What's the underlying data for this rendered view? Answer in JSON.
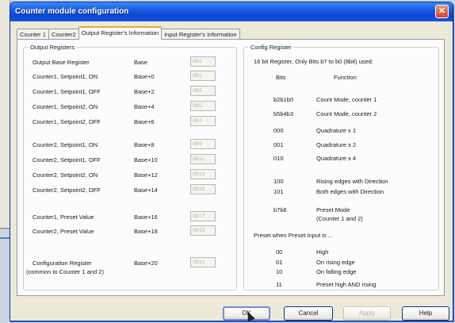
{
  "dialog": {
    "title": "Counter module configuration",
    "close_glyph": "✕"
  },
  "tabs": [
    {
      "label": "Counter 1"
    },
    {
      "label": "Counter2"
    },
    {
      "label": "Output Register's Information"
    },
    {
      "label": "Input Register's Information"
    }
  ],
  "output_registers": {
    "title": "Output Registers",
    "rows": [
      {
        "label": "Output Base Register",
        "base": "Base",
        "value": "0B1"
      },
      {
        "label": "Counter1, Setpoint1, ON",
        "base": "Base+0",
        "value": "0B1"
      },
      {
        "label": "Counter1, Setpoint1, OFF",
        "base": "Base+2",
        "value": "0B3"
      },
      {
        "label": "Counter1, Setpoint2, ON",
        "base": "Base+4",
        "value": "0B5"
      },
      {
        "label": "Counter1, Setpoint2, OFF",
        "base": "Base+6",
        "value": "0B7"
      },
      {
        "label": "Counter2, Setpoint1, ON",
        "base": "Base+8",
        "value": "0B9"
      },
      {
        "label": "Counter2, Setpoint1, OFF",
        "base": "Base+10",
        "value": "0B11"
      },
      {
        "label": "Counter2, Setpoint2, ON",
        "base": "Base+12",
        "value": "0B13"
      },
      {
        "label": "Counter2, Setpoint2, OFF",
        "base": "Base+14",
        "value": "0B15"
      },
      {
        "label": "Counter1, Preset Value",
        "base": "Base+16",
        "value": "0B17"
      },
      {
        "label": "Counter2, Preset Value",
        "base": "Base+18",
        "value": "0B19"
      },
      {
        "label": "Configuration Register",
        "label2": "(common to Counter 1 and 2)",
        "base": "Base+20",
        "value": "0B21"
      }
    ]
  },
  "config_register": {
    "title": "Config Register",
    "intro": "16 bit Register, Only Bits b7 to b0 (8bit) used:",
    "col_bits": "Bits",
    "col_function": "Function",
    "rows": [
      {
        "bits": "b2b1b0",
        "function": "Count Mode, counter 1"
      },
      {
        "bits": "b5b4b3",
        "function": "Count Mode, counter 2"
      },
      {
        "bits": "000",
        "function": "Quadrature x 1"
      },
      {
        "bits": "001",
        "function": "Quadrature x 2"
      },
      {
        "bits": "010",
        "function": "Quadrature x 4"
      },
      {
        "bits": "100",
        "function": "Rising edges with Direction"
      },
      {
        "bits": "101",
        "function": "Both edges with Direction"
      },
      {
        "bits": "b7b6",
        "function": "Preset Mode",
        "function2": "(Counter 1 and 2)"
      }
    ],
    "preset_heading": "Preset when Preset Input is ...",
    "preset_rows": [
      {
        "bits": "00",
        "function": "High"
      },
      {
        "bits": "01",
        "function": "On rising edge"
      },
      {
        "bits": "10",
        "function": "On falling edge"
      },
      {
        "bits": "11",
        "function": "Preset high AND rising"
      }
    ]
  },
  "buttons": {
    "ok": "OK",
    "cancel": "Cancel",
    "apply": "Apply",
    "help": "Help"
  }
}
